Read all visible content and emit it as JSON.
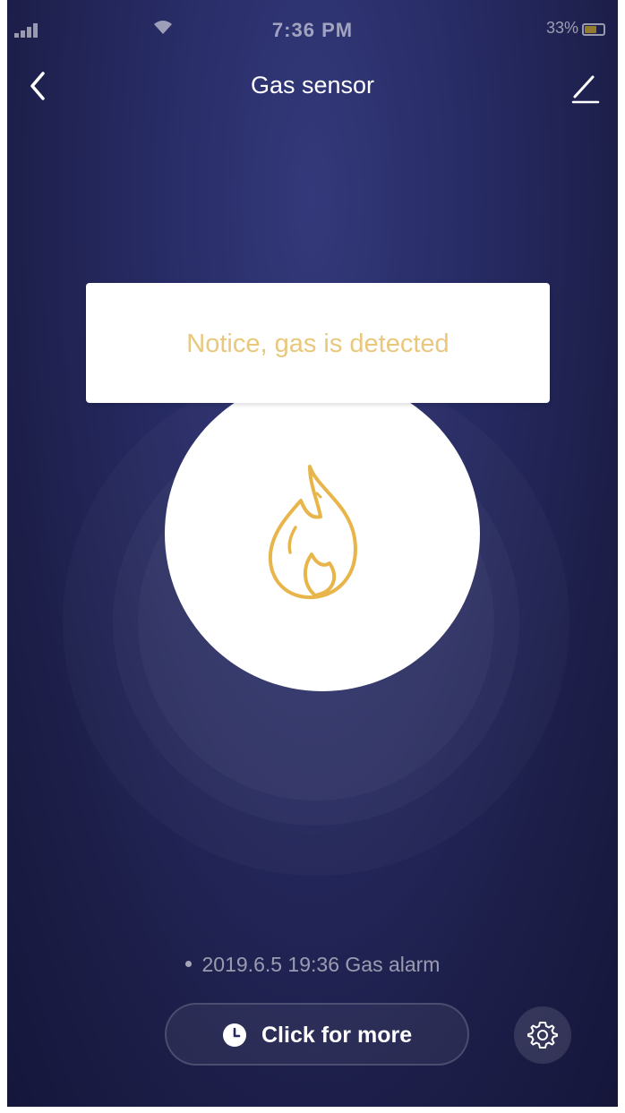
{
  "status_bar": {
    "time": "7:36 PM",
    "battery_percent": "33%",
    "battery_level": 0.6
  },
  "nav": {
    "title": "Gas sensor",
    "back_icon": "chevron-left-icon",
    "edit_icon": "pencil-icon"
  },
  "notice": {
    "text": "Notice, gas is detected"
  },
  "sensor": {
    "icon": "flame-icon",
    "status_color": "#e9c77c"
  },
  "log": {
    "latest_entry": "2019.6.5 19:36 Gas alarm"
  },
  "actions": {
    "more_label": "Click for more",
    "more_icon": "clock-icon",
    "settings_icon": "gear-icon"
  }
}
